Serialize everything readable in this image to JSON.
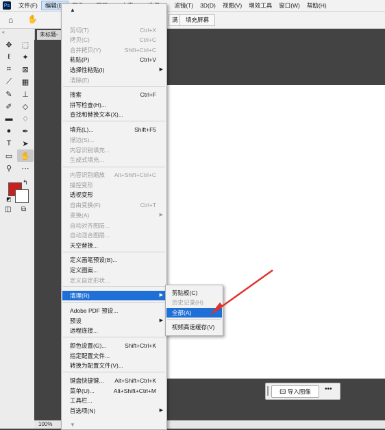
{
  "menubar": {
    "logo": "Ps",
    "items": [
      "文件(F)",
      "编辑(E)",
      "图像(I)",
      "图层(L)",
      "文字(Y)",
      "选择(S)",
      "滤镜(T)",
      "3D(D)",
      "视图(V)",
      "增效工具",
      "窗口(W)",
      "帮助(H)"
    ],
    "active_index": 1
  },
  "optbar": {
    "fill_screen": "填充屏幕",
    "fit_button_suffix": "满"
  },
  "document": {
    "tab_title": "未标题-",
    "zoom": "100%"
  },
  "float_bar": {
    "import_label": "导入图像",
    "more": "•••"
  },
  "colors": {
    "foreground": "#c8201f",
    "background": "#ffffff",
    "highlight": "#1e6fd6",
    "annotation_arrow": "#e0312b"
  },
  "edit_menu": {
    "items": [
      {
        "label": "剪切(T)",
        "shortcut": "Ctrl+X",
        "disabled": true
      },
      {
        "label": "拷贝(C)",
        "shortcut": "Ctrl+C",
        "disabled": true
      },
      {
        "label": "合并拷贝(Y)",
        "shortcut": "Shift+Ctrl+C",
        "disabled": true
      },
      {
        "label": "粘贴(P)",
        "shortcut": "Ctrl+V",
        "disabled": false
      },
      {
        "label": "选择性粘贴(I)",
        "shortcut": "",
        "disabled": false,
        "submenu": true
      },
      {
        "label": "清除(E)",
        "shortcut": "",
        "disabled": true
      },
      {
        "label": "搜索",
        "shortcut": "Ctrl+F",
        "disabled": false
      },
      {
        "label": "拼写检查(H)...",
        "shortcut": "",
        "disabled": false
      },
      {
        "label": "查找和替换文本(X)...",
        "shortcut": "",
        "disabled": false
      },
      {
        "label": "填充(L)...",
        "shortcut": "Shift+F5",
        "disabled": false
      },
      {
        "label": "描边(S)...",
        "shortcut": "",
        "disabled": true
      },
      {
        "label": "内容识别填充...",
        "shortcut": "",
        "disabled": true
      },
      {
        "label": "生成式填充...",
        "shortcut": "",
        "disabled": true
      },
      {
        "label": "内容识别缩放",
        "shortcut": "Alt+Shift+Ctrl+C",
        "disabled": true
      },
      {
        "label": "操控变形",
        "shortcut": "",
        "disabled": true
      },
      {
        "label": "透视变形",
        "shortcut": "",
        "disabled": false
      },
      {
        "label": "自由变换(F)",
        "shortcut": "Ctrl+T",
        "disabled": true
      },
      {
        "label": "变换(A)",
        "shortcut": "",
        "disabled": true,
        "submenu": true
      },
      {
        "label": "自动对齐图层...",
        "shortcut": "",
        "disabled": true
      },
      {
        "label": "自动混合图层...",
        "shortcut": "",
        "disabled": true
      },
      {
        "label": "天空替换...",
        "shortcut": "",
        "disabled": false
      },
      {
        "label": "定义画笔预设(B)...",
        "shortcut": "",
        "disabled": false
      },
      {
        "label": "定义图案...",
        "shortcut": "",
        "disabled": false
      },
      {
        "label": "定义自定形状...",
        "shortcut": "",
        "disabled": true
      },
      {
        "label": "清理(R)",
        "shortcut": "",
        "disabled": false,
        "submenu": true,
        "highlighted": true
      },
      {
        "label": "Adobe PDF 预设...",
        "shortcut": "",
        "disabled": false
      },
      {
        "label": "预设",
        "shortcut": "",
        "disabled": false,
        "submenu": true
      },
      {
        "label": "远程连接...",
        "shortcut": "",
        "disabled": false
      },
      {
        "label": "颜色设置(G)...",
        "shortcut": "Shift+Ctrl+K",
        "disabled": false
      },
      {
        "label": "指定配置文件...",
        "shortcut": "",
        "disabled": false
      },
      {
        "label": "转换为配置文件(V)...",
        "shortcut": "",
        "disabled": false
      },
      {
        "label": "键盘快捷键...",
        "shortcut": "Alt+Shift+Ctrl+K",
        "disabled": false
      },
      {
        "label": "菜单(U)...",
        "shortcut": "Alt+Shift+Ctrl+M",
        "disabled": false
      },
      {
        "label": "工具栏...",
        "shortcut": "",
        "disabled": false
      },
      {
        "label": "首选项(N)",
        "shortcut": "",
        "disabled": false,
        "submenu": true
      }
    ]
  },
  "purge_submenu": {
    "items": [
      {
        "label": "剪贴板(C)",
        "disabled": false
      },
      {
        "label": "历史记录(H)",
        "disabled": true
      },
      {
        "label": "全部(A)",
        "disabled": false,
        "highlighted": true
      },
      {
        "label": "视频高速缓存(V)",
        "disabled": false
      }
    ]
  }
}
